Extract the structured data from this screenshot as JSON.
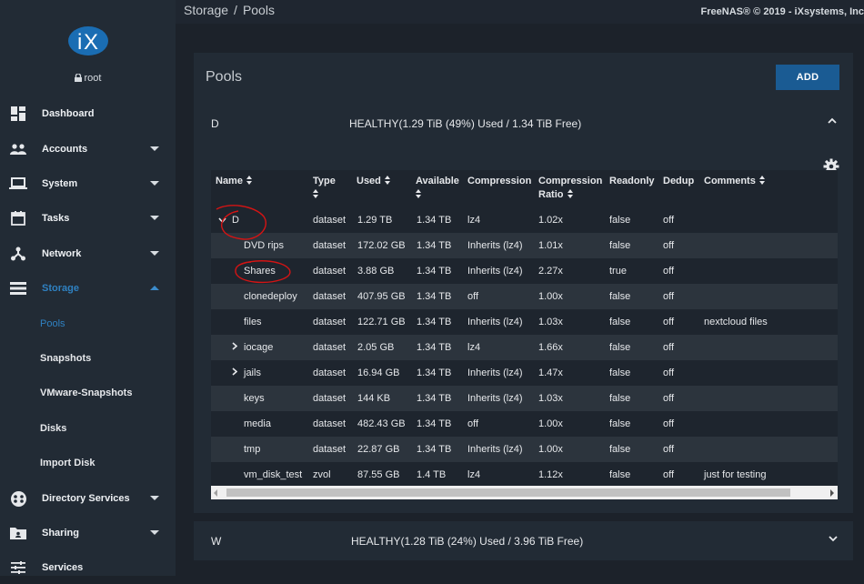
{
  "user": {
    "name": "root"
  },
  "sidebar": {
    "items": [
      {
        "label": "Dashboard",
        "icon": "dashboard-icon",
        "caret": false
      },
      {
        "label": "Accounts",
        "icon": "people-icon",
        "caret": true
      },
      {
        "label": "System",
        "icon": "laptop-icon",
        "caret": true
      },
      {
        "label": "Tasks",
        "icon": "calendar-icon",
        "caret": true
      },
      {
        "label": "Network",
        "icon": "network-icon",
        "caret": true
      },
      {
        "label": "Storage",
        "icon": "storage-icon",
        "caret": true,
        "active": true
      },
      {
        "label": "Directory Services",
        "icon": "directory-icon",
        "caret": true
      },
      {
        "label": "Sharing",
        "icon": "folder-share-icon",
        "caret": true
      },
      {
        "label": "Services",
        "icon": "sliders-icon",
        "caret": false
      }
    ],
    "storage_sub": [
      "Pools",
      "Snapshots",
      "VMware-Snapshots",
      "Disks",
      "Import Disk"
    ]
  },
  "breadcrumb": {
    "section": "Storage",
    "separator": "/",
    "page": "Pools"
  },
  "copyright": "FreeNAS® © 2019 - iXsystems, Inc",
  "pools_card": {
    "title": "Pools",
    "add_label": "ADD"
  },
  "pool_d": {
    "name": "D",
    "status": "HEALTHY(1.29 TiB (49%) Used / 1.34 TiB Free)",
    "expanded": true
  },
  "pool_w": {
    "name": "W",
    "status": "HEALTHY(1.28 TiB (24%) Used / 3.96 TiB Free)",
    "expanded": false
  },
  "table": {
    "headers": {
      "name": "Name",
      "type": "Type",
      "used": "Used",
      "available": "Available",
      "compression": "Compression",
      "compression_ratio_1": "Compression",
      "compression_ratio_2": "Ratio",
      "readonly": "Readonly",
      "dedup": "Dedup",
      "comments": "Comments"
    },
    "rows": [
      {
        "name": "D",
        "type": "dataset",
        "used": "1.29 TB",
        "available": "1.34 TB",
        "compression": "lz4",
        "ratio": "1.02x",
        "readonly": "false",
        "dedup": "off",
        "comments": "",
        "toggle": "expanded"
      },
      {
        "name": "DVD rips",
        "type": "dataset",
        "used": "172.02 GB",
        "available": "1.34 TB",
        "compression": "Inherits (lz4)",
        "ratio": "1.01x",
        "readonly": "false",
        "dedup": "off",
        "comments": ""
      },
      {
        "name": "Shares",
        "type": "dataset",
        "used": "3.88 GB",
        "available": "1.34 TB",
        "compression": "Inherits (lz4)",
        "ratio": "2.27x",
        "readonly": "true",
        "dedup": "off",
        "comments": ""
      },
      {
        "name": "clonedeploy",
        "type": "dataset",
        "used": "407.95 GB",
        "available": "1.34 TB",
        "compression": "off",
        "ratio": "1.00x",
        "readonly": "false",
        "dedup": "off",
        "comments": ""
      },
      {
        "name": "files",
        "type": "dataset",
        "used": "122.71 GB",
        "available": "1.34 TB",
        "compression": "Inherits (lz4)",
        "ratio": "1.03x",
        "readonly": "false",
        "dedup": "off",
        "comments": "nextcloud files"
      },
      {
        "name": "iocage",
        "type": "dataset",
        "used": "2.05 GB",
        "available": "1.34 TB",
        "compression": "lz4",
        "ratio": "1.66x",
        "readonly": "false",
        "dedup": "off",
        "comments": "",
        "toggle": "collapsed"
      },
      {
        "name": "jails",
        "type": "dataset",
        "used": "16.94 GB",
        "available": "1.34 TB",
        "compression": "Inherits (lz4)",
        "ratio": "1.47x",
        "readonly": "false",
        "dedup": "off",
        "comments": "",
        "toggle": "collapsed"
      },
      {
        "name": "keys",
        "type": "dataset",
        "used": "144 KB",
        "available": "1.34 TB",
        "compression": "Inherits (lz4)",
        "ratio": "1.03x",
        "readonly": "false",
        "dedup": "off",
        "comments": ""
      },
      {
        "name": "media",
        "type": "dataset",
        "used": "482.43 GB",
        "available": "1.34 TB",
        "compression": "off",
        "ratio": "1.00x",
        "readonly": "false",
        "dedup": "off",
        "comments": ""
      },
      {
        "name": "tmp",
        "type": "dataset",
        "used": "22.87 GB",
        "available": "1.34 TB",
        "compression": "Inherits (lz4)",
        "ratio": "1.00x",
        "readonly": "false",
        "dedup": "off",
        "comments": ""
      },
      {
        "name": "vm_disk_test",
        "type": "zvol",
        "used": "87.55 GB",
        "available": "1.4 TB",
        "compression": "lz4",
        "ratio": "1.12x",
        "readonly": "false",
        "dedup": "off",
        "comments": "just for testing"
      }
    ]
  },
  "colors": {
    "accent": "#2f81c1",
    "add_button": "#1a5b93",
    "annotation": "#d41414"
  }
}
